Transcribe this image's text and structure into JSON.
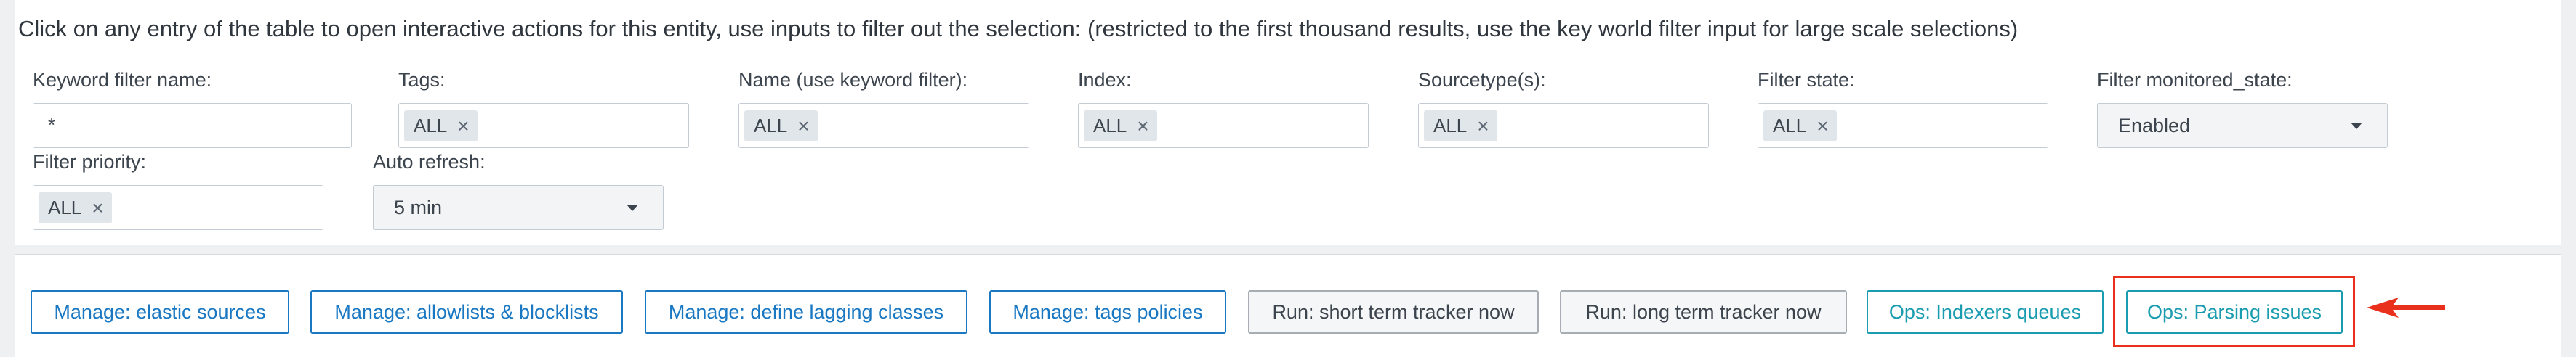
{
  "description": "Click on any entry of the table to open interactive actions for this entity, use inputs to filter out the selection: (restricted to the first thousand results, use the key world filter input for large scale selections)",
  "filters": {
    "keyword": {
      "label": "Keyword filter name:",
      "value": "*"
    },
    "tags": {
      "label": "Tags:",
      "tag": "ALL"
    },
    "name": {
      "label": "Name (use keyword filter):",
      "tag": "ALL"
    },
    "index": {
      "label": "Index:",
      "tag": "ALL"
    },
    "sourcetype": {
      "label": "Sourcetype(s):",
      "tag": "ALL"
    },
    "state": {
      "label": "Filter state:",
      "tag": "ALL"
    },
    "monitored_state": {
      "label": "Filter monitored_state:",
      "value": "Enabled"
    },
    "priority": {
      "label": "Filter priority:",
      "tag": "ALL"
    },
    "auto_refresh": {
      "label": "Auto refresh:",
      "value": "5 min"
    }
  },
  "remove_glyph": "×",
  "buttons": {
    "elastic_sources": "Manage: elastic sources",
    "allowlists": "Manage: allowlists & blocklists",
    "lagging_classes": "Manage: define lagging classes",
    "tags_policies": "Manage: tags policies",
    "short_term": "Run: short term tracker now",
    "long_term": "Run: long term tracker now",
    "indexers_queues": "Ops: Indexers queues",
    "parsing_issues": "Ops: Parsing issues"
  },
  "colors": {
    "primary": "#1a78c2",
    "ops": "#1a9cb0",
    "annotation": "#e8301d"
  }
}
